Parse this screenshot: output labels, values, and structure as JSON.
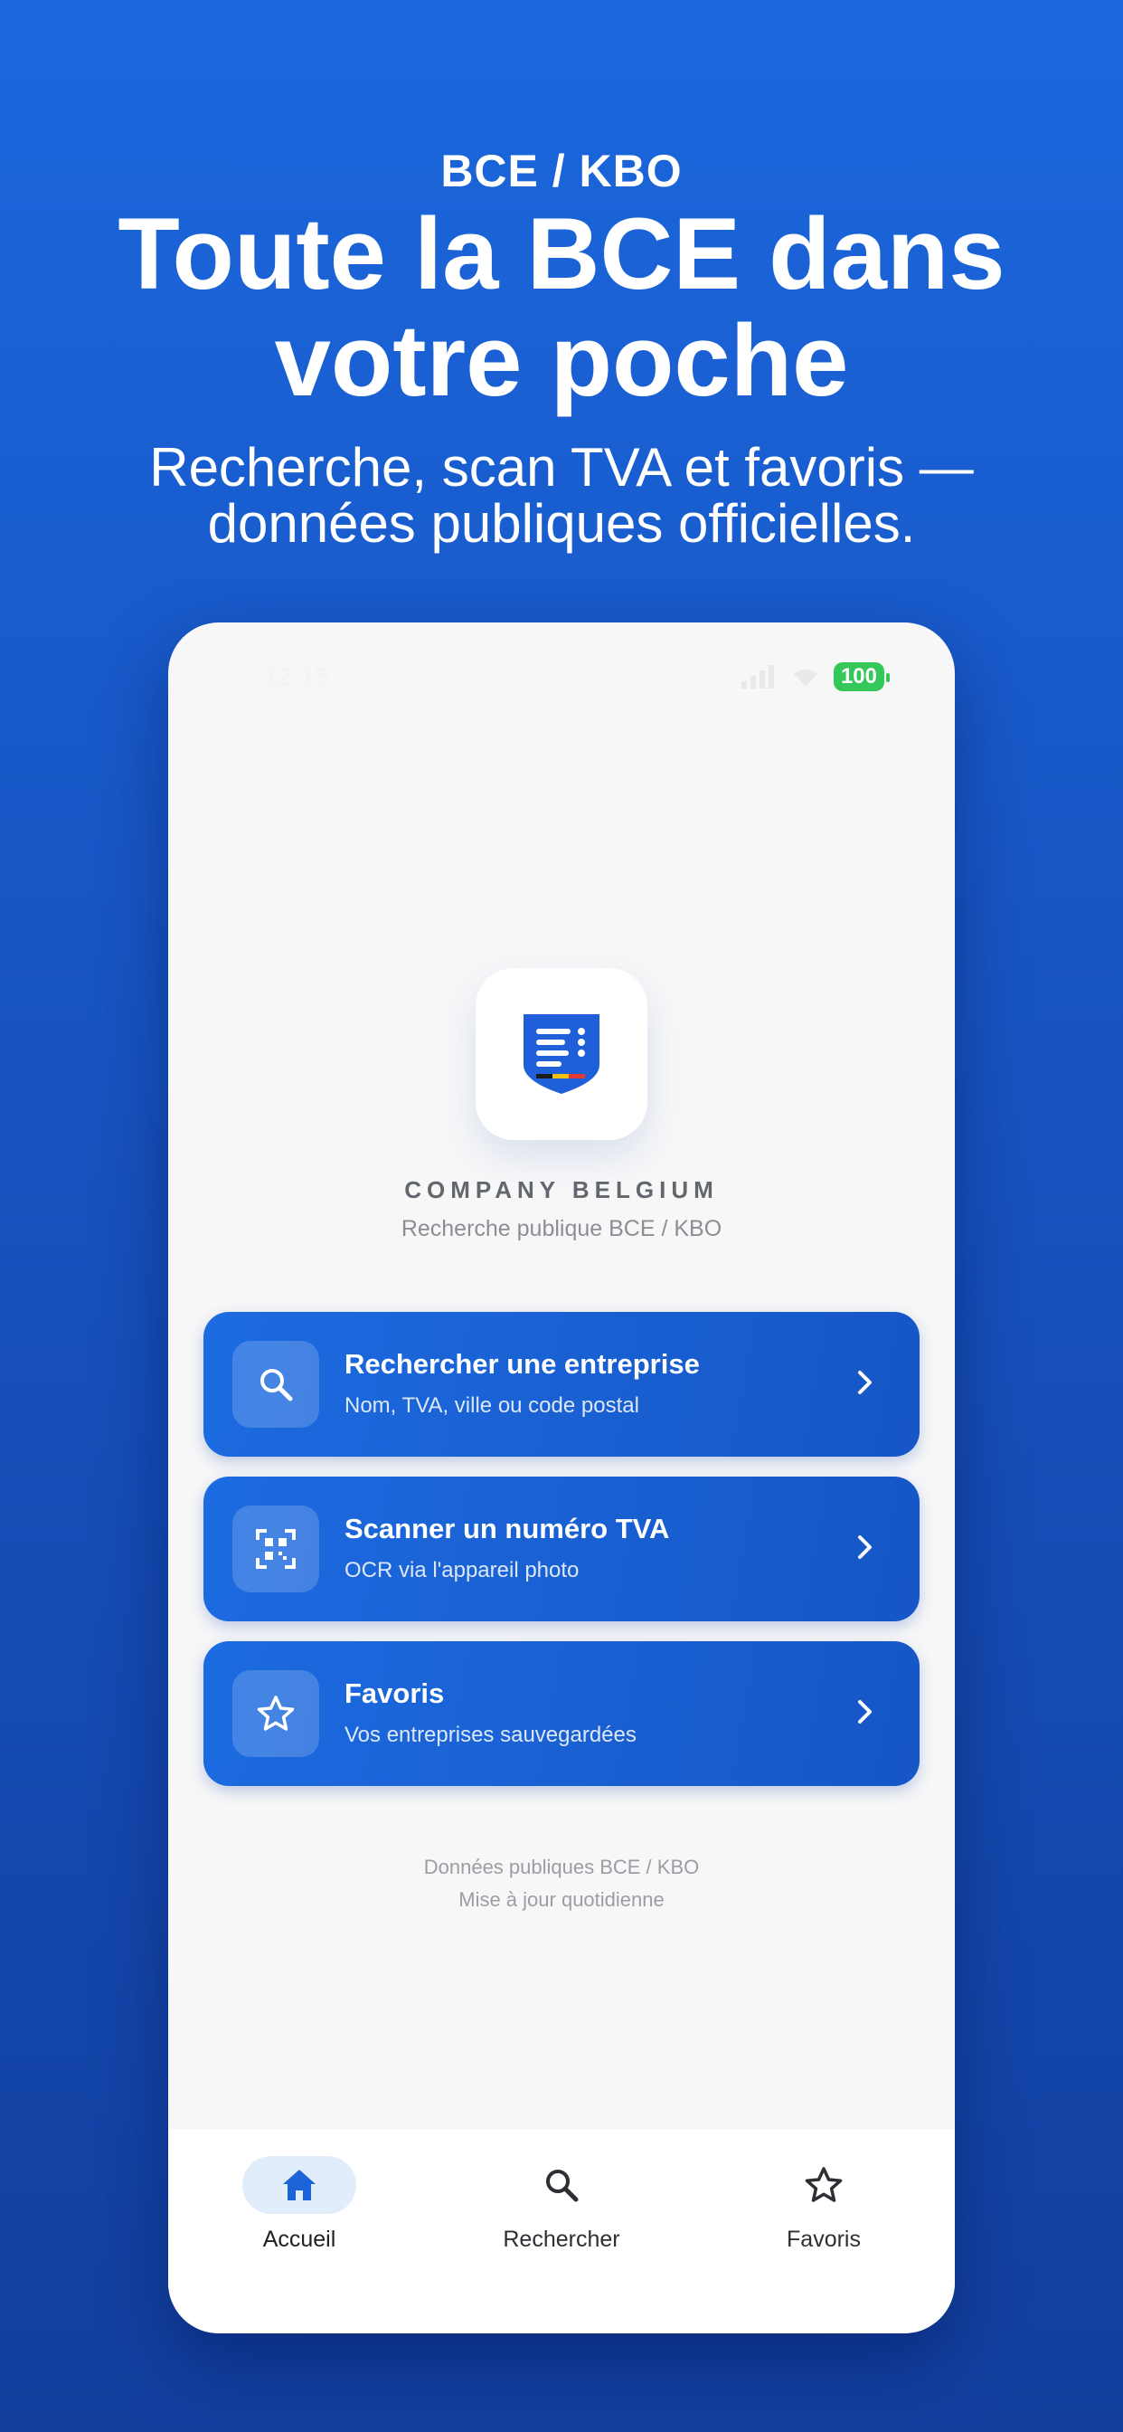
{
  "hero": {
    "eyebrow": "BCE / KBO",
    "headline_line1": "Toute la BCE dans",
    "headline_line2": "votre poche",
    "subhead_line1": "Recherche, scan TVA et favoris —",
    "subhead_line2": "données publiques officielles."
  },
  "status_bar": {
    "time": "12:15",
    "battery": "100"
  },
  "app": {
    "name": "COMPANY BELGIUM",
    "tagline": "Recherche publique BCE / KBO",
    "accent_color": "#1c6be0"
  },
  "actions": [
    {
      "title": "Rechercher une entreprise",
      "subtitle": "Nom, TVA, ville ou code postal",
      "icon": "search-icon"
    },
    {
      "title": "Scanner un numéro TVA",
      "subtitle": "OCR via l'appareil photo",
      "icon": "qr-scan-icon"
    },
    {
      "title": "Favoris",
      "subtitle": "Vos entreprises sauvegardées",
      "icon": "star-icon"
    }
  ],
  "footer": {
    "line1": "Données publiques BCE / KBO",
    "line2": "Mise à jour quotidienne"
  },
  "tabs": [
    {
      "label": "Accueil",
      "icon": "home-icon",
      "active": true
    },
    {
      "label": "Rechercher",
      "icon": "search-icon",
      "active": false
    },
    {
      "label": "Favoris",
      "icon": "star-icon",
      "active": false
    }
  ]
}
